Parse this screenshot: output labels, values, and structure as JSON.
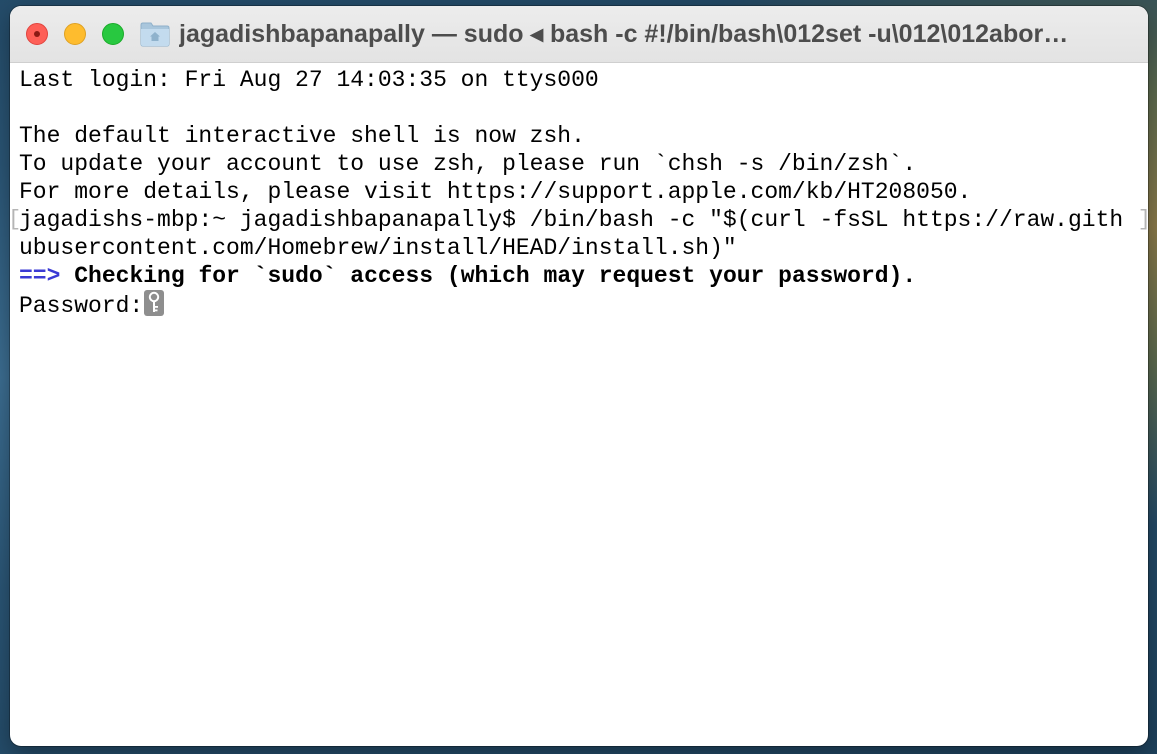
{
  "window": {
    "title": "jagadishbapanapally — sudo ◂ bash -c #!/bin/bash\\012set -u\\012\\012abor…",
    "icons": {
      "close": "close-icon",
      "minimize": "minimize-icon",
      "maximize": "maximize-icon",
      "folder": "home-folder-icon",
      "key": "key-icon"
    }
  },
  "terminal": {
    "lines": [
      "Last login: Fri Aug 27 14:03:35 on ttys000",
      "",
      "The default interactive shell is now zsh.",
      "To update your account to use zsh, please run `chsh -s /bin/zsh`.",
      "For more details, please visit https://support.apple.com/kb/HT208050.",
      "jagadishs-mbp:~ jagadishbapanapally$ /bin/bash -c \"$(curl -fsSL https://raw.gith",
      "ubusercontent.com/Homebrew/install/HEAD/install.sh)\""
    ],
    "status_arrow": "==>",
    "status_message": "Checking for `sudo` access (which may request your password).",
    "password_prompt": "Password:",
    "mark_left": "[",
    "mark_right": "]"
  },
  "colors": {
    "arrow": "#3a3ad4",
    "close": "#fe5f57",
    "minimize": "#febc2e",
    "maximize": "#28c840"
  }
}
